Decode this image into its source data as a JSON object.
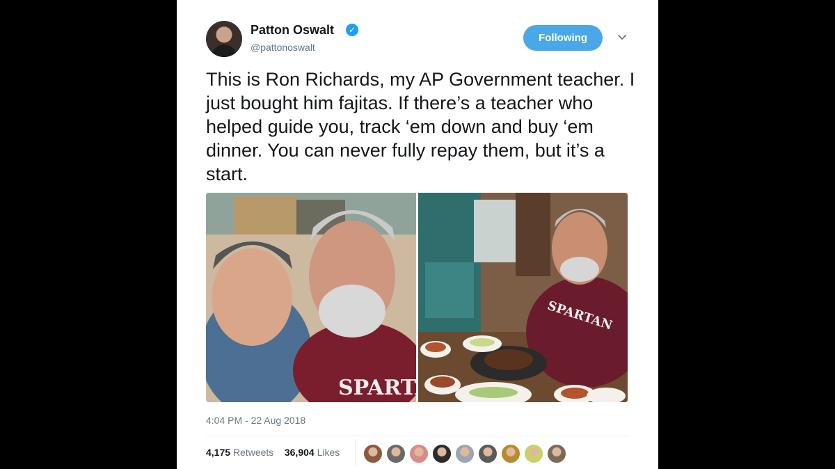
{
  "tweet": {
    "author_name": "Patton Oswalt",
    "verified_icon": "verified-badge-icon",
    "handle": "@pattonoswalt",
    "follow_button": "Following",
    "menu_icon": "chevron-down-icon",
    "text": "This is Ron Richards, my AP Government teacher. I just bought him fajitas. If there’s a teacher who helped guide you, track ‘em down and buy ‘em dinner. You can never fully repay them, but it’s a start.",
    "timestamp": "4:04 PM - 22 Aug 2018",
    "retweets_count": "4,175",
    "retweets_label": "Retweets",
    "likes_count": "36,904",
    "likes_label": "Likes",
    "photo_shirt_text_1": "SPARTA",
    "photo_shirt_text_2": "SPARTAN"
  },
  "colors": {
    "accent": "#1da1f2",
    "follow_button": "#4aa8e8",
    "secondary_text": "#657786",
    "primary_text": "#14171a"
  },
  "likers": [
    "#8b5a3c",
    "#6a6a6a",
    "#d98a8a",
    "#2c2c2c",
    "#9aa6b2",
    "#5a5a5a",
    "#b8892e",
    "#c7d36a",
    "#7a6a5a"
  ]
}
